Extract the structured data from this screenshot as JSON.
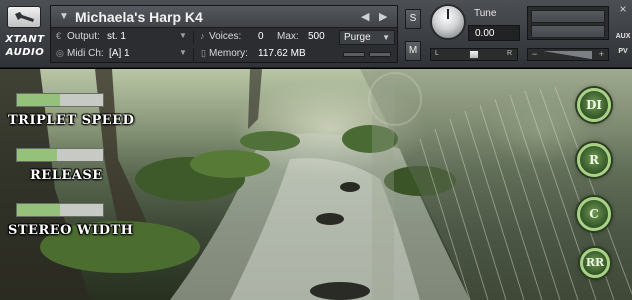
{
  "header": {
    "brand_line1": "XTANT",
    "brand_line2": "AUDIO",
    "instrument_name": "Michaela's Harp K4",
    "output_label": "Output:",
    "output_value": "st. 1",
    "voices_label": "Voices:",
    "voices_value": "0",
    "max_label": "Max:",
    "max_value": "500",
    "purge_label": "Purge",
    "midi_label": "Midi Ch:",
    "midi_value": "[A]  1",
    "memory_label": "Memory:",
    "memory_value": "117.62 MB",
    "solo_label": "S",
    "mute_label": "M",
    "tune_label": "Tune",
    "tune_value": "0.00",
    "pan_left": "L",
    "pan_right": "R",
    "vol_minus": "−",
    "vol_plus": "+",
    "aux_label": "AUX",
    "pv_label": "PV",
    "close_glyph": "×"
  },
  "controls": {
    "triplet_speed": {
      "label": "TRIPLET SPEED",
      "level": 0.5
    },
    "release": {
      "label": "RELEASE",
      "level": 0.47
    },
    "stereo_width": {
      "label": "STEREO WIDTH",
      "level": 0.5
    }
  },
  "buttons": {
    "di": "DI",
    "r": "R",
    "c": "C",
    "rr": "RR"
  },
  "colors": {
    "accent_green": "#94c27b",
    "button_ring": "#a8d387",
    "header_bg": "#3a3d41"
  }
}
